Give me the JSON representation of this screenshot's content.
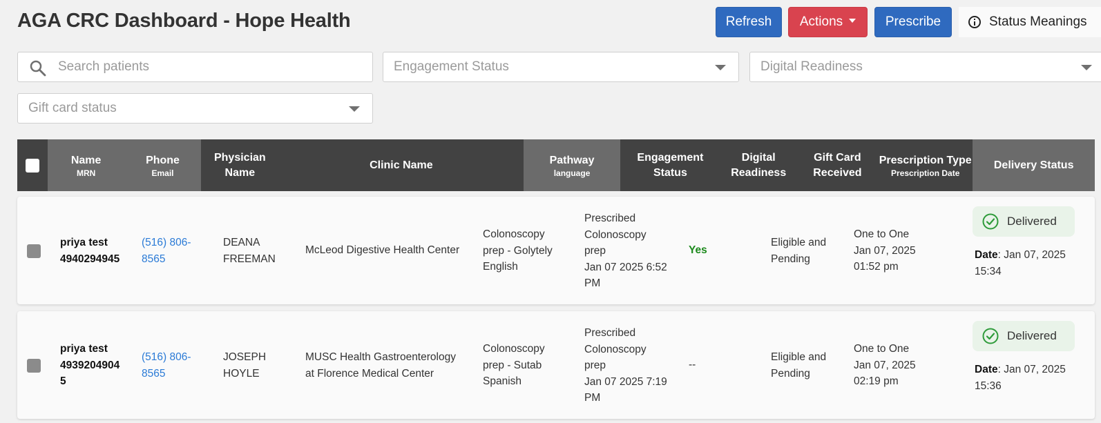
{
  "title": "AGA CRC Dashboard - Hope Health",
  "buttons": {
    "refresh": "Refresh",
    "actions": "Actions",
    "prescribe": "Prescribe",
    "status_meanings": "Status Meanings"
  },
  "filters": {
    "search_placeholder": "Search patients",
    "engagement": "Engagement Status",
    "digital": "Digital Readiness",
    "gift": "Gift card status"
  },
  "columns": {
    "name": "Name",
    "name_sub": "MRN",
    "phone": "Phone",
    "phone_sub": "Email",
    "physician_l1": "Physician",
    "physician_l2": "Name",
    "clinic": "Clinic Name",
    "pathway": "Pathway",
    "pathway_sub": "language",
    "engagement_l1": "Engagement",
    "engagement_l2": "Status",
    "digital_l1": "Digital",
    "digital_l2": "Readiness",
    "gift_l1": "Gift Card",
    "gift_l2": "Received",
    "rx": "Prescription Type",
    "rx_sub": "Prescription Date",
    "delivery": "Delivery Status"
  },
  "rows": [
    {
      "name": "priya test",
      "mrn": "4940294945",
      "phone_l1": "(516) 806-",
      "phone_l2": "8565",
      "physician_l1": "DEANA",
      "physician_l2": "FREEMAN",
      "clinic_l1": "McLeod Digestive Health Center",
      "clinic_l2": "",
      "pathway_l1": "Colonoscopy",
      "pathway_l2": "prep - Golytely",
      "pathway_l3": "English",
      "eng_l1": "Prescribed",
      "eng_l2": "Colonoscopy",
      "eng_l3": "prep",
      "eng_l4": "Jan 07 2025 6:52",
      "eng_l5": "PM",
      "digital": "Yes",
      "gift_l1": "Eligible and",
      "gift_l2": "Pending",
      "rx_type": "One to One",
      "rx_date": "Jan 07, 2025",
      "rx_time": "01:52 pm",
      "delivery": "Delivered",
      "date_label": "Date",
      "del_date": ": Jan 07, 2025",
      "del_time": "15:34"
    },
    {
      "name": "priya test",
      "mrn": "4939204904 5",
      "phone_l1": "(516) 806-",
      "phone_l2": "8565",
      "physician_l1": "JOSEPH",
      "physician_l2": "HOYLE",
      "clinic_l1": "MUSC Health Gastroenterology",
      "clinic_l2": "at Florence Medical Center",
      "pathway_l1": "Colonoscopy",
      "pathway_l2": "prep - Sutab",
      "pathway_l3": "Spanish",
      "eng_l1": "Prescribed",
      "eng_l2": "Colonoscopy",
      "eng_l3": "prep",
      "eng_l4": "Jan 07 2025 7:19",
      "eng_l5": "PM",
      "digital": "--",
      "gift_l1": "Eligible and",
      "gift_l2": "Pending",
      "rx_type": "One to One",
      "rx_date": "Jan 07, 2025",
      "rx_time": "02:19 pm",
      "delivery": "Delivered",
      "date_label": "Date",
      "del_date": ": Jan 07, 2025",
      "del_time": "15:36"
    }
  ],
  "colors": {
    "primary": "#2f6abf",
    "danger": "#d9434f",
    "header_dark": "#424242",
    "header_mid": "#6b6b6b",
    "link": "#2a7ad6",
    "success": "#1d8a1d",
    "badge_bg": "#e9f3e9"
  },
  "icons": [
    "search-icon",
    "info-icon",
    "chevron-down-icon",
    "check-circle-icon"
  ]
}
